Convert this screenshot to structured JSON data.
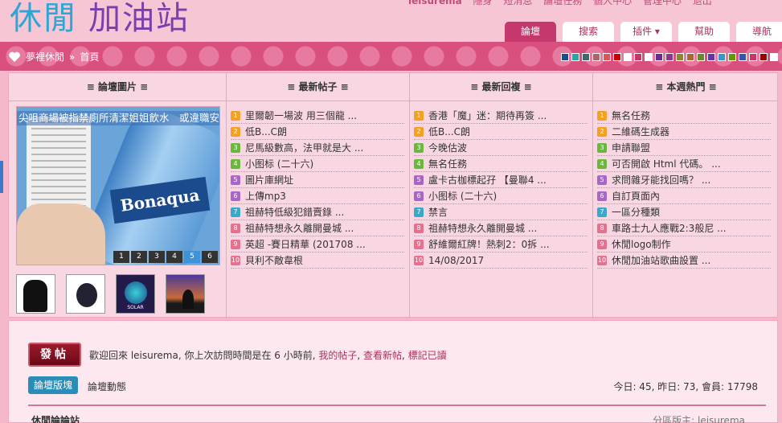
{
  "logo": {
    "part1": "休閒",
    "part2": "加油站"
  },
  "toplinks": [
    "leisurema",
    "隱身",
    "短消息",
    "論壇任務",
    "個人中心",
    "管理中心",
    "退出"
  ],
  "nav": [
    {
      "label": "論壇",
      "active": true
    },
    {
      "label": "搜索",
      "active": false
    },
    {
      "label": "插件",
      "active": false,
      "dropdown": "▾"
    },
    {
      "label": "幫助",
      "active": false
    },
    {
      "label": "導航",
      "active": false
    }
  ],
  "breadcrumb": {
    "site": "夢裡休閒",
    "sep": "»",
    "page": "首頁"
  },
  "swatches": [
    "#1e4a8e",
    "#2aa3a3",
    "#3d6b6b",
    "#aa6666",
    "#dd5555",
    "#cc0000",
    "#ffffff",
    "#cc3366",
    "#ffffff",
    "#6a2a8e",
    "#8a3a8a",
    "#888833",
    "#aa6633",
    "#668833",
    "#6633aa",
    "#3399cc",
    "#669900",
    "#3355aa",
    "#cc3366",
    "#990000",
    "#ffffff"
  ],
  "columns": {
    "c1": "≡ 論壇圖片 ≡",
    "c2": "≡ 最新帖子 ≡",
    "c3": "≡ 最新回複 ≡",
    "c4": "≡ 本週熱門 ≡"
  },
  "slideshow": {
    "caption": "尖咀商場被指禁廁所清潔姐姐飲水　或違職安條",
    "bottle_label": "Bonaqua",
    "pages": [
      "1",
      "2",
      "3",
      "4",
      "5",
      "6"
    ],
    "active_page": 5
  },
  "thumbs": [
    {
      "text": ""
    },
    {
      "text": ""
    },
    {
      "text": "SOLAR"
    },
    {
      "text": ""
    }
  ],
  "latest_posts": [
    "里爾韌一場波 用三個龍 ...",
    "低B...C朗",
    "尼馬級數高，法甲就是大 ...",
    "小图标 (二十六)",
    "圖片庫網址",
    "上傳mp3",
    "祖赫特低級犯錯賣錄 ...",
    "祖赫特想永久離開曼城 ...",
    "英超 -賽日精華 (201708 ...",
    "貝利不敵韋根"
  ],
  "latest_replies": [
    "香港「魔」迷：期待再簽 ...",
    "低B...C朗",
    "今晚估波",
    "無名任務",
    "盧卡古枷標起孖 【曼聯4 ...",
    "小图标 (二十六)",
    "禁言",
    "祖赫特想永久離開曼城 ...",
    "舒維爾紅牌！熱刺2：0拆 ...",
    "14/08/2017"
  ],
  "weekly_hot": [
    "無名任務",
    "二維碼生成器",
    "申請聯盟",
    "可否開啟 Html 代碼。 ...",
    "求問雜牙能找回嗎？ ...",
    "自訂頁面內",
    "一區分種類",
    "車路士九人應戰2:3般尼 ...",
    "休閒logo制作",
    "休閒加油站歌曲設置 ..."
  ],
  "bottom": {
    "post_button": "發帖",
    "welcome_prefix": "歡迎回來 leisurema, 你上次訪問時間是在 6 小時前,",
    "links": [
      "我的帖子",
      "查看新帖",
      "標記已讀"
    ],
    "forum_tab": "論壇版塊",
    "forum_dynamic": "論壇動態",
    "stats": "今日: 45, 昨日: 73, 會員: 17798",
    "section_title": "休閒論論站",
    "moderator": "分區版主: leisurema"
  }
}
